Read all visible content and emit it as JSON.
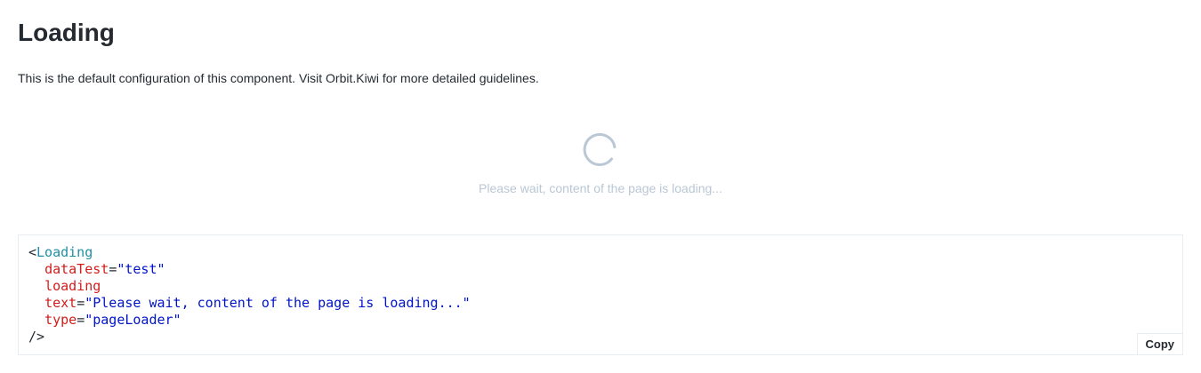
{
  "page": {
    "title": "Loading",
    "description": "This is the default configuration of this component. Visit Orbit.Kiwi for more detailed guidelines."
  },
  "loader": {
    "icon": "spinner-icon",
    "text": "Please wait, content of the page is loading...",
    "text_color": "#bac7d5",
    "spinner_color": "#bac7d5"
  },
  "code": {
    "open": "<",
    "component": "Loading",
    "props": [
      {
        "name": "dataTest",
        "eq": "=",
        "value": "\"test\""
      },
      {
        "name": "loading",
        "eq": "",
        "value": ""
      },
      {
        "name": "text",
        "eq": "=",
        "value": "\"Please wait, content of the page is loading...\""
      },
      {
        "name": "type",
        "eq": "=",
        "value": "\"pageLoader\""
      }
    ],
    "close": "/>",
    "copy_label": "Copy"
  },
  "colors": {
    "tag": "#1f8fa3",
    "attr": "#d21c1c",
    "string": "#0014c8"
  }
}
